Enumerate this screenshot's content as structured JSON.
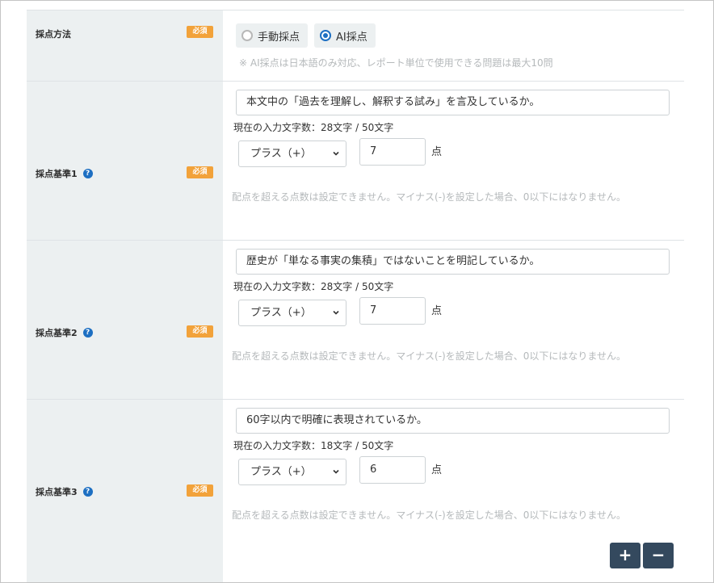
{
  "required_label": "必須",
  "method": {
    "label": "採点方法",
    "options": [
      {
        "label": "手動採点",
        "selected": false
      },
      {
        "label": "AI採点",
        "selected": true
      }
    ],
    "note": "※ AI採点は日本語のみ対応、レポート単位で使用できる問題は最大10問"
  },
  "criteria": [
    {
      "label": "採点基準1",
      "text": "本文中の「過去を理解し、解釈する試み」を言及しているか。",
      "char_count": "現在の入力文字数：28文字 / 50文字",
      "sign": "プラス（+）",
      "score": "7",
      "unit": "点",
      "note": "配点を超える点数は設定できません。マイナス(-)を設定した場合、0以下にはなりません。"
    },
    {
      "label": "採点基準2",
      "text": "歴史が「単なる事実の集積」ではないことを明記しているか。",
      "char_count": "現在の入力文字数：28文字 / 50文字",
      "sign": "プラス（+）",
      "score": "7",
      "unit": "点",
      "note": "配点を超える点数は設定できません。マイナス(-)を設定した場合、0以下にはなりません。"
    },
    {
      "label": "採点基準3",
      "text": "60字以内で明確に表現されているか。",
      "char_count": "現在の入力文字数：18文字 / 50文字",
      "sign": "プラス（+）",
      "score": "6",
      "unit": "点",
      "note": "配点を超える点数は設定できません。マイナス(-)を設定した場合、0以下にはなりません。"
    }
  ],
  "buttons": {
    "add": "+",
    "remove": "−"
  },
  "colors": {
    "accent": "#1d6fc2",
    "required_badge": "#f2a23a",
    "button_dark": "#34495e",
    "header_bg": "#ecf0f1"
  }
}
